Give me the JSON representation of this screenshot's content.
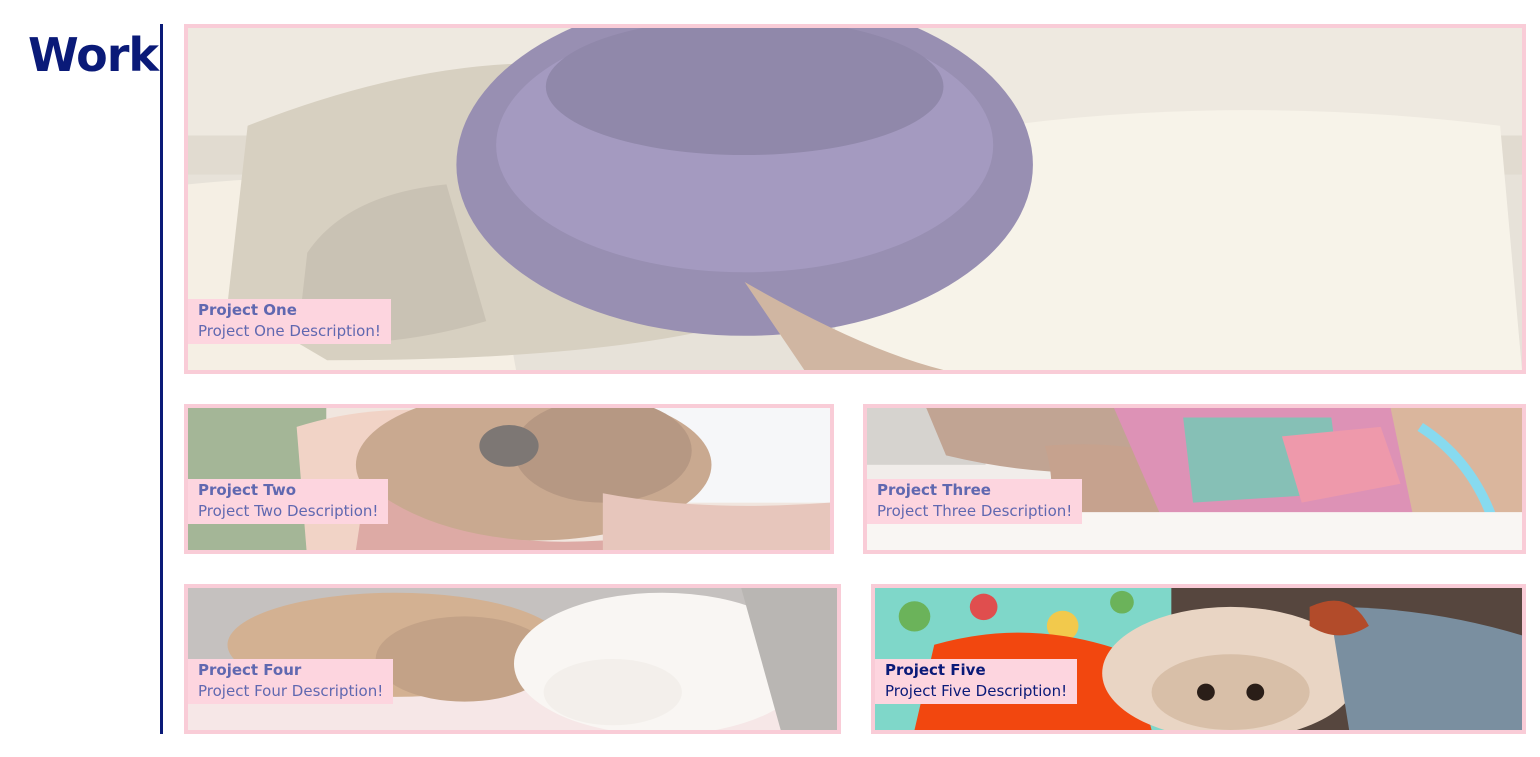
{
  "section": {
    "title": "Work"
  },
  "colors": {
    "brand_navy": "#0a1a78",
    "card_border": "#f9ccd7",
    "caption_bg": "#fdd5df",
    "caption_text_muted": "#6068b0"
  },
  "projects": [
    {
      "title": "Project One",
      "description": "Project One Description!",
      "photo_subject": "dog wearing a knitted purple scarf on a cream blanket"
    },
    {
      "title": "Project Two",
      "description": "Project Two Description!",
      "photo_subject": "brown dog resting head on a person's arm"
    },
    {
      "title": "Project Three",
      "description": "Project Three Description!",
      "photo_subject": "dog in a floral shirt lying on a bed"
    },
    {
      "title": "Project Four",
      "description": "Project Four Description!",
      "photo_subject": "tan dog and white fluffy dog sleeping on pink blanket"
    },
    {
      "title": "Project Five",
      "description": "Project Five Description!",
      "photo_subject": "fluffy dog in orange sweater on a patterned blanket"
    }
  ]
}
